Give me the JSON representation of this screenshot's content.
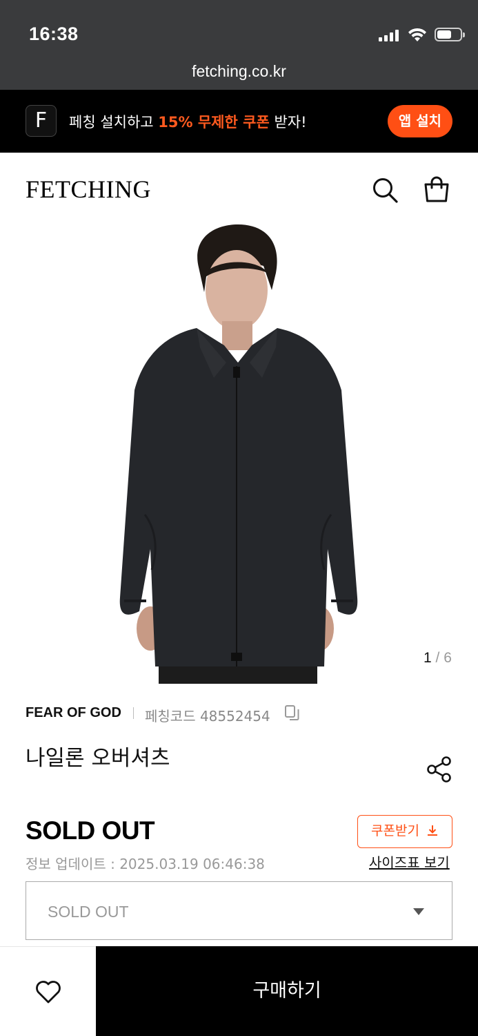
{
  "status_bar": {
    "time": "16:38",
    "url": "fetching.co.kr"
  },
  "banner": {
    "icon_letter": "F",
    "text_prefix": "페칭 설치하고 ",
    "text_highlight": "15% 무제한 쿠폰",
    "text_suffix": " 받자!",
    "install_label": "앱 설치",
    "accent_color": "#ff4f14"
  },
  "header": {
    "logo": "FETCHING",
    "icons": [
      "search-icon",
      "shopping-bag-icon"
    ]
  },
  "gallery": {
    "current": "1",
    "separator": " / ",
    "total": "6"
  },
  "product": {
    "brand": "FEAR OF GOD",
    "code_label": "페칭코드 48552454",
    "name": "나일론 오버셔츠",
    "status": "SOLD OUT",
    "coupon_label": "쿠폰받기",
    "update_info": "정보 업데이트 : 2025.03.19 06:46:38",
    "size_chart_label": "사이즈표 보기",
    "option_selected": "SOLD OUT"
  },
  "bottom_bar": {
    "buy_label": "구매하기"
  }
}
